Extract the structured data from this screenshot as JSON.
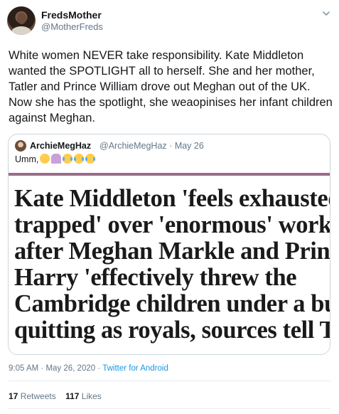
{
  "author": {
    "display_name": "FredsMother",
    "handle": "@MotherFreds"
  },
  "tweet": {
    "text": "White women NEVER take responsibility. Kate Middleton wanted the SPOTLIGHT all to herself. She and her mother, Tatler and Prince William drove out Meghan out of the UK. Now she has the spotlight, she weaopinises her infant children against Meghan."
  },
  "quoted_tweet": {
    "display_name": "ArchieMegHaz",
    "handle": "@ArchieMegHaz",
    "date": "May 26",
    "separator": "·",
    "text": "Umm,",
    "emojis": [
      "thinking-face-icon",
      "person-facepalming-icon",
      "face-with-tears-of-joy-icon",
      "face-with-tears-of-joy-icon",
      "face-with-tears-of-joy-icon"
    ],
    "image_headline_lines": [
      "Kate Middleton 'feels exhausted and",
      "trapped' over 'enormous' workload",
      "after Meghan Markle and Prince",
      "Harry 'effectively threw the",
      "Cambridge children under a bus' by",
      "quitting as royals, sources tell Tatler"
    ]
  },
  "meta": {
    "time": "9:05 AM",
    "date": "May 26, 2020",
    "separator": "·",
    "source": "Twitter for Android"
  },
  "stats": {
    "retweets_count": "17",
    "retweets_label": "Retweets",
    "likes_count": "117",
    "likes_label": "Likes"
  },
  "colors": {
    "link": "#1b95e0",
    "secondary_text": "#657786",
    "border": "#ccd6dd"
  }
}
